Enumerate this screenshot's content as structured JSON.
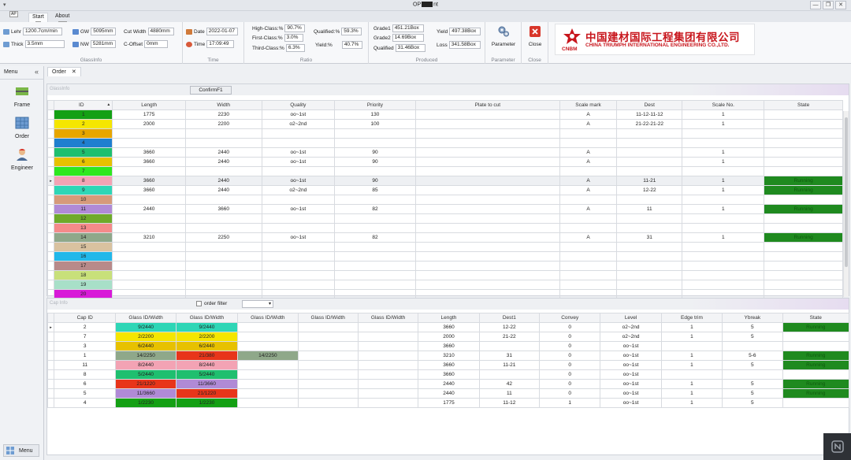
{
  "window": {
    "title": "OP",
    "title_suffix": "nt",
    "qa_label": "▾",
    "controls": [
      "—",
      "❐",
      "✕"
    ]
  },
  "ribbon_tabs": [
    {
      "label": "Start",
      "badge": "S"
    },
    {
      "label": "About",
      "badge": "AB"
    }
  ],
  "quick_badge": "AP",
  "glassinfo": {
    "caption": "GlassInfo",
    "lehr_label": "Lehr",
    "lehr_value": "1200.7cm/min",
    "thick_label": "Thick",
    "thick_value": "3.5mm",
    "gw_label": "GW",
    "gw_value": "5095mm",
    "nw_label": "NW",
    "nw_value": "5281mm",
    "cut_width_label": "Cut Width",
    "cut_width_value": "4880mm",
    "c_offset_label": "C-Offset",
    "c_offset_value": "0mm"
  },
  "time": {
    "caption": "Time",
    "date_label": "Date",
    "date_value": "2022-01-07",
    "time_label": "Time",
    "time_value": "17:09:49"
  },
  "ratio": {
    "caption": "Ratio",
    "high_label": "High-Class:%",
    "high_value": "90.7%",
    "first_label": "First-Class:%",
    "first_value": "3.0%",
    "third_label": "Third-Class:%",
    "third_value": "6.3%",
    "qualified_label": "Qualified:%",
    "qualified_value": "59.3%",
    "yield_label": "Yield:%",
    "yield_value": "40.7%"
  },
  "produced": {
    "caption": "Produced",
    "grade1_label": "Grade1",
    "grade1_value": "451.21Box",
    "grade2_label": "Grade2",
    "grade2_value": "14.69Box",
    "qualified_label": "Qualified",
    "qualified_value": "31.46Box",
    "yield_label": "Yield",
    "yield_value": "497.38Box",
    "loss_label": "Loss",
    "loss_value": "341.58Box"
  },
  "parameter": {
    "caption": "Parameter",
    "button_label": "Parameter"
  },
  "close": {
    "caption": "Close",
    "button_label": "Close"
  },
  "logo": {
    "mark_text": "CNBM",
    "cn_text": "中国建材国际工程集团有限公司",
    "en_text": "CHINA TRIUMPH INTERNATIONAL ENGINEERING CO.,LTD."
  },
  "left_menu": {
    "header": "Menu",
    "collapse": "«",
    "items": [
      "Frame",
      "Order",
      "Engineer"
    ],
    "bottom_button": "Menu"
  },
  "doc_tab": {
    "label": "Order",
    "close": "✕"
  },
  "order_panel": {
    "label": "GlassInfo",
    "confirm_button": "ConfirmF1",
    "headers": [
      "ID",
      "Length",
      "Width",
      "Quality",
      "Priority",
      "Plate to cut",
      "Scale mark",
      "Dest",
      "Scale No.",
      "State"
    ],
    "rows": [
      {
        "id": "1",
        "color": "#14a014",
        "length": "1775",
        "width": "2230",
        "quality": "oo~1st",
        "priority": "130",
        "plate": "",
        "scale": "A",
        "dest": "11-12-11-12",
        "scaleno": "1",
        "state": ""
      },
      {
        "id": "2",
        "color": "#f5e600",
        "length": "2000",
        "width": "2200",
        "quality": "o2~2nd",
        "priority": "100",
        "plate": "",
        "scale": "A",
        "dest": "21-22-21-22",
        "scaleno": "1",
        "state": ""
      },
      {
        "id": "3",
        "color": "#e7a600",
        "length": "",
        "width": "",
        "quality": "",
        "priority": "",
        "plate": "",
        "scale": "",
        "dest": "",
        "scaleno": "",
        "state": ""
      },
      {
        "id": "4",
        "color": "#1f7fcf",
        "length": "",
        "width": "",
        "quality": "",
        "priority": "",
        "plate": "",
        "scale": "",
        "dest": "",
        "scaleno": "",
        "state": ""
      },
      {
        "id": "5",
        "color": "#1fbf6f",
        "length": "3660",
        "width": "2440",
        "quality": "oo~1st",
        "priority": "90",
        "plate": "",
        "scale": "A",
        "dest": "",
        "scaleno": "1",
        "state": ""
      },
      {
        "id": "6",
        "color": "#e7c100",
        "length": "3660",
        "width": "2440",
        "quality": "oo~1st",
        "priority": "90",
        "plate": "",
        "scale": "A",
        "dest": "",
        "scaleno": "1",
        "state": ""
      },
      {
        "id": "7",
        "color": "#2ee81f",
        "length": "",
        "width": "",
        "quality": "",
        "priority": "",
        "plate": "",
        "scale": "",
        "dest": "",
        "scaleno": "",
        "state": ""
      },
      {
        "id": "8",
        "color": "#f3a3b4",
        "length": "3660",
        "width": "2440",
        "quality": "oo~1st",
        "priority": "90",
        "plate": "",
        "scale": "A",
        "dest": "11-21",
        "scaleno": "1",
        "state": "Running"
      },
      {
        "id": "9",
        "color": "#2ed6b6",
        "length": "3660",
        "width": "2440",
        "quality": "o2~2nd",
        "priority": "85",
        "plate": "",
        "scale": "A",
        "dest": "12-22",
        "scaleno": "1",
        "state": "Running"
      },
      {
        "id": "10",
        "color": "#d69a7a",
        "length": "",
        "width": "",
        "quality": "",
        "priority": "",
        "plate": "",
        "scale": "",
        "dest": "",
        "scaleno": "",
        "state": ""
      },
      {
        "id": "11",
        "color": "#b08ad6",
        "length": "2440",
        "width": "3660",
        "quality": "oo~1st",
        "priority": "82",
        "plate": "",
        "scale": "A",
        "dest": "11",
        "scaleno": "1",
        "state": "Running"
      },
      {
        "id": "12",
        "color": "#6faa2a",
        "length": "",
        "width": "",
        "quality": "",
        "priority": "",
        "plate": "",
        "scale": "",
        "dest": "",
        "scaleno": "",
        "state": ""
      },
      {
        "id": "13",
        "color": "#f58a8a",
        "length": "",
        "width": "",
        "quality": "",
        "priority": "",
        "plate": "",
        "scale": "",
        "dest": "",
        "scaleno": "",
        "state": ""
      },
      {
        "id": "14",
        "color": "#8fa88a",
        "length": "3210",
        "width": "2250",
        "quality": "oo~1st",
        "priority": "82",
        "plate": "",
        "scale": "A",
        "dest": "31",
        "scaleno": "1",
        "state": "Running"
      },
      {
        "id": "15",
        "color": "#d9c2a0",
        "length": "",
        "width": "",
        "quality": "",
        "priority": "",
        "plate": "",
        "scale": "",
        "dest": "",
        "scaleno": "",
        "state": ""
      },
      {
        "id": "16",
        "color": "#22b8ea",
        "length": "",
        "width": "",
        "quality": "",
        "priority": "",
        "plate": "",
        "scale": "",
        "dest": "",
        "scaleno": "",
        "state": ""
      },
      {
        "id": "17",
        "color": "#b88a8a",
        "length": "",
        "width": "",
        "quality": "",
        "priority": "",
        "plate": "",
        "scale": "",
        "dest": "",
        "scaleno": "",
        "state": ""
      },
      {
        "id": "18",
        "color": "#c8e07a",
        "length": "",
        "width": "",
        "quality": "",
        "priority": "",
        "plate": "",
        "scale": "",
        "dest": "",
        "scaleno": "",
        "state": ""
      },
      {
        "id": "19",
        "color": "#a8e0c8",
        "length": "",
        "width": "",
        "quality": "",
        "priority": "",
        "plate": "",
        "scale": "",
        "dest": "",
        "scaleno": "",
        "state": ""
      },
      {
        "id": "20",
        "color": "#d81ad8",
        "length": "",
        "width": "",
        "quality": "",
        "priority": "",
        "plate": "",
        "scale": "",
        "dest": "",
        "scaleno": "",
        "state": ""
      }
    ]
  },
  "cap_panel": {
    "label": "Cap Info",
    "filter_label": "order filter",
    "headers": [
      "Cap ID",
      "Glass ID/Width",
      "Glass ID/Width",
      "Glass ID/Width",
      "Glass ID/Width",
      "Glass ID/Width",
      "Length",
      "Dest1",
      "Convey",
      "Level",
      "Edge trim",
      "Ybreak",
      "State"
    ],
    "rows": [
      {
        "cap": "2",
        "g": [
          [
            "9/2440",
            "#2ed6b6"
          ],
          [
            "9/2440",
            "#2ed6b6"
          ],
          [
            "",
            ""
          ],
          [
            "",
            ""
          ],
          [
            "",
            ""
          ]
        ],
        "length": "3660",
        "dest": "12-22",
        "convey": "0",
        "level": "o2~2nd",
        "edge": "1",
        "ybreak": "5",
        "state": "Running"
      },
      {
        "cap": "7",
        "g": [
          [
            "2/2200",
            "#f5e600"
          ],
          [
            "2/2200",
            "#f5e600"
          ],
          [
            "",
            ""
          ],
          [
            "",
            ""
          ],
          [
            "",
            ""
          ]
        ],
        "length": "2000",
        "dest": "21-22",
        "convey": "0",
        "level": "o2~2nd",
        "edge": "1",
        "ybreak": "5",
        "state": ""
      },
      {
        "cap": "3",
        "g": [
          [
            "6/2440",
            "#e7c100"
          ],
          [
            "6/2440",
            "#e7c100"
          ],
          [
            "",
            ""
          ],
          [
            "",
            ""
          ],
          [
            "",
            ""
          ]
        ],
        "length": "3660",
        "dest": "",
        "convey": "0",
        "level": "oo~1st",
        "edge": "",
        "ybreak": "",
        "state": ""
      },
      {
        "cap": "1",
        "g": [
          [
            "14/2250",
            "#8fa88a"
          ],
          [
            "21/380",
            "#e8351a"
          ],
          [
            "14/2250",
            "#8fa88a"
          ],
          [
            "",
            ""
          ],
          [
            "",
            ""
          ]
        ],
        "length": "3210",
        "dest": "31",
        "convey": "0",
        "level": "oo~1st",
        "edge": "1",
        "ybreak": "5-6",
        "state": "Running"
      },
      {
        "cap": "11",
        "g": [
          [
            "8/2440",
            "#f3a3b4"
          ],
          [
            "8/2440",
            "#f3a3b4"
          ],
          [
            "",
            ""
          ],
          [
            "",
            ""
          ],
          [
            "",
            ""
          ]
        ],
        "length": "3660",
        "dest": "11-21",
        "convey": "0",
        "level": "oo~1st",
        "edge": "1",
        "ybreak": "5",
        "state": "Running"
      },
      {
        "cap": "8",
        "g": [
          [
            "5/2440",
            "#1fbf6f"
          ],
          [
            "5/2440",
            "#1fbf6f"
          ],
          [
            "",
            ""
          ],
          [
            "",
            ""
          ],
          [
            "",
            ""
          ]
        ],
        "length": "3660",
        "dest": "",
        "convey": "0",
        "level": "oo~1st",
        "edge": "",
        "ybreak": "",
        "state": ""
      },
      {
        "cap": "6",
        "g": [
          [
            "21/1220",
            "#e8351a"
          ],
          [
            "11/3660",
            "#b08ad6"
          ],
          [
            "",
            ""
          ],
          [
            "",
            ""
          ],
          [
            "",
            ""
          ]
        ],
        "length": "2440",
        "dest": "42",
        "convey": "0",
        "level": "oo~1st",
        "edge": "1",
        "ybreak": "5",
        "state": "Running"
      },
      {
        "cap": "5",
        "g": [
          [
            "11/3660",
            "#b08ad6"
          ],
          [
            "21/1220",
            "#e8351a"
          ],
          [
            "",
            ""
          ],
          [
            "",
            ""
          ],
          [
            "",
            ""
          ]
        ],
        "length": "2440",
        "dest": "11",
        "convey": "0",
        "level": "oo~1st",
        "edge": "1",
        "ybreak": "5",
        "state": "Running"
      },
      {
        "cap": "4",
        "g": [
          [
            "1/2230",
            "#14a014"
          ],
          [
            "1/2230",
            "#14a014"
          ],
          [
            "",
            ""
          ],
          [
            "",
            ""
          ],
          [
            "",
            ""
          ]
        ],
        "length": "1775",
        "dest": "11-12",
        "convey": "1",
        "level": "oo~1st",
        "edge": "1",
        "ybreak": "5",
        "state": ""
      }
    ]
  }
}
